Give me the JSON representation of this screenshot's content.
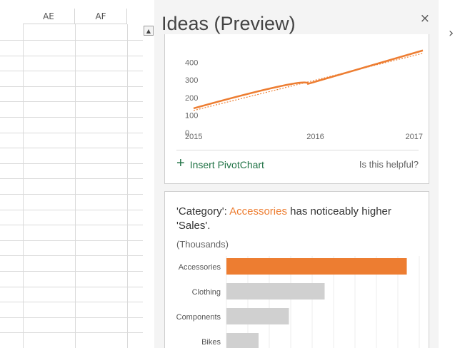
{
  "sheet": {
    "columns": [
      "AE",
      "AF"
    ]
  },
  "pane": {
    "title": "Ideas (Preview)",
    "close_glyph": "×",
    "expand_glyph": "›"
  },
  "card1": {
    "insert_label": "Insert PivotChart",
    "plus_glyph": "+",
    "helpful_label": "Is this helpful?"
  },
  "card2": {
    "text_prefix": "'Category': ",
    "highlight": "Accessories",
    "text_suffix": " has noticeably higher 'Sales'.",
    "units": "(Thousands)"
  },
  "chart_data": [
    {
      "type": "line",
      "x": [
        2015,
        2016,
        2017
      ],
      "y_ticks": [
        0,
        100,
        200,
        300,
        400
      ],
      "ylim": [
        0,
        500
      ],
      "series": [
        {
          "values": [
            110,
            250,
            440
          ]
        }
      ],
      "trendline": true,
      "color": "#ed7d31"
    },
    {
      "type": "bar",
      "orientation": "horizontal",
      "categories": [
        "Accessories",
        "Clothing",
        "Components",
        "Bikes"
      ],
      "values": [
        1010,
        550,
        350,
        180
      ],
      "highlight_color": "#ed7d31",
      "bar_color": "#d0d0d0"
    }
  ]
}
